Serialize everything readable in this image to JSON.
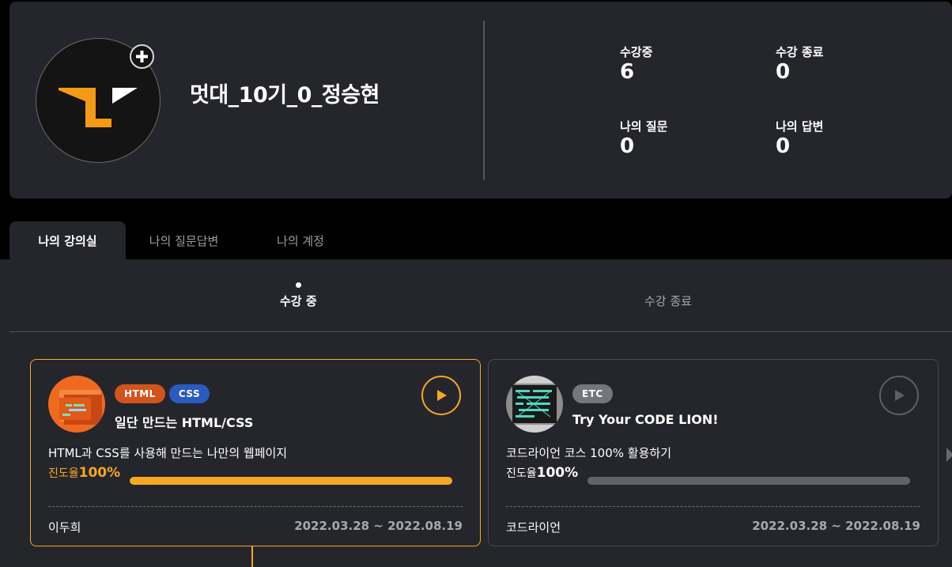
{
  "profile": {
    "username": "멋대_10기_0_정승현",
    "add_symbol": "+",
    "stats": [
      {
        "label": "수강중",
        "value": "6"
      },
      {
        "label": "수강 종료",
        "value": "0"
      },
      {
        "label": "나의 질문",
        "value": "0"
      },
      {
        "label": "나의 답변",
        "value": "0"
      }
    ]
  },
  "tabs": [
    {
      "label": "나의 강의실",
      "active": true
    },
    {
      "label": "나의 질문답변",
      "active": false
    },
    {
      "label": "나의 계정",
      "active": false
    }
  ],
  "subtabs": [
    {
      "label": "수강 중",
      "active": true
    },
    {
      "label": "수강 종료",
      "active": false
    }
  ],
  "courses": [
    {
      "tags": [
        {
          "label": "HTML",
          "color": "#d4531c"
        },
        {
          "label": "CSS",
          "color": "#2a5bc0"
        }
      ],
      "title": "일단 만드는 HTML/CSS",
      "description": "HTML과 CSS를 사용해 만드는 나만의 웹페이지",
      "progress_label": "진도율",
      "progress_value": "100%",
      "progress": 1.0,
      "accent": "#f7a823",
      "teacher": "이두희",
      "period": "2022.03.28 ~ 2022.08.19",
      "thumb_icon": "html-css-course-icon",
      "selected": true
    },
    {
      "tags": [
        {
          "label": "ETC",
          "color": "#75767c"
        }
      ],
      "title": "Try Your CODE LION!",
      "description": "코드라이언 코스 100% 활용하기",
      "progress_label": "진도율",
      "progress_value": "100%",
      "progress": 1.0,
      "accent": "#62636a",
      "teacher": "코드라이언",
      "period": "2022.03.28 ~ 2022.08.19",
      "thumb_icon": "code-lion-course-icon",
      "selected": false
    }
  ],
  "colors": {
    "background": "#000000",
    "panel": "#25262c",
    "accent": "#f7a823"
  }
}
